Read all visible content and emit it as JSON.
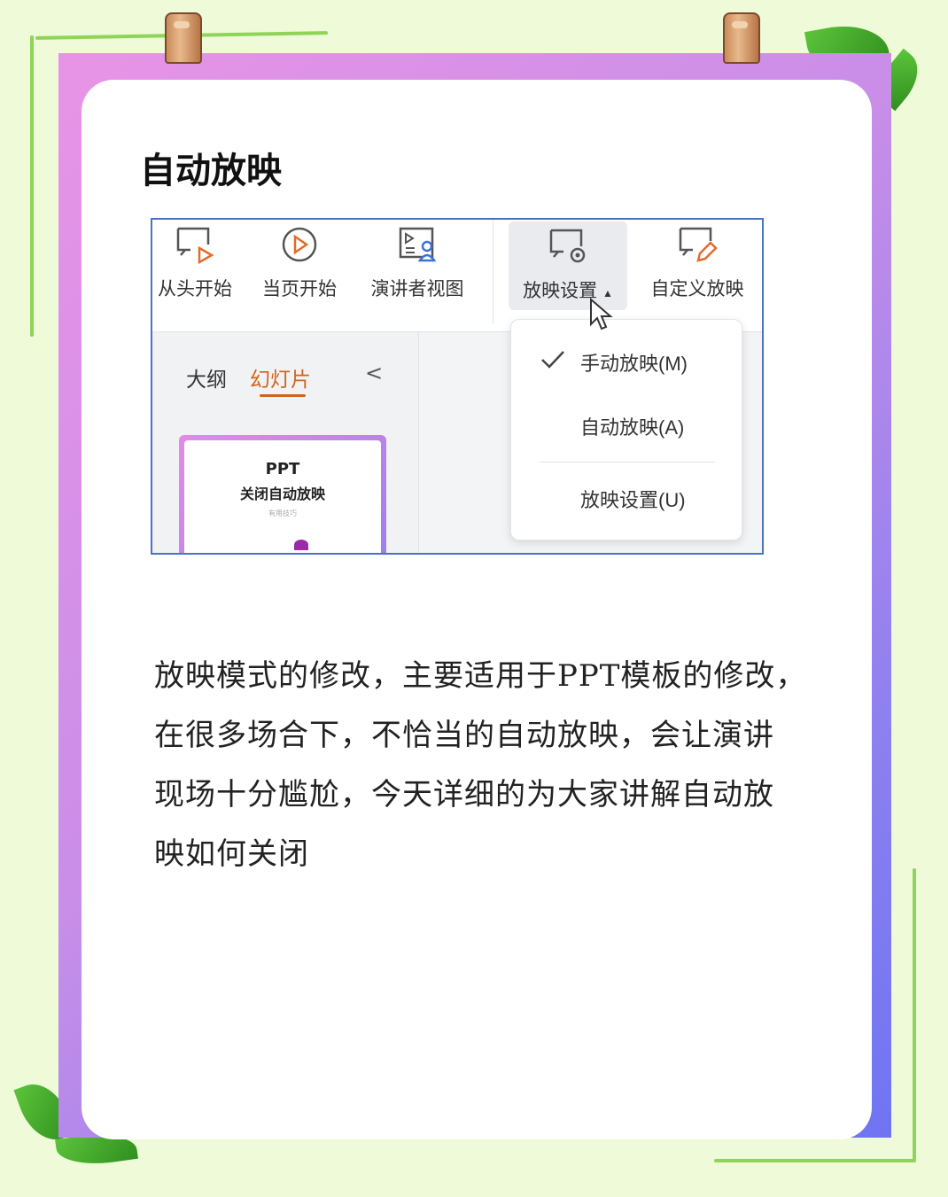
{
  "post": {
    "title": "自动放映",
    "body_lines": [
      "放映模式的修改，主要适用于PPT模板的修改，",
      "在很多场合下，不恰当的自动放映，会让演讲",
      "现场十分尴尬，今天详细的为大家讲解自动放",
      "映如何关闭"
    ]
  },
  "screenshot": {
    "toolbar": {
      "from_start": "从头开始",
      "from_current": "当页开始",
      "presenter_view": "演讲者视图",
      "slideshow_settings": "放映设置",
      "custom_show": "自定义放映"
    },
    "panel": {
      "tab_outline": "大纲",
      "tab_slides": "幻灯片",
      "collapse_glyph": "<",
      "thumb_line1": "PPT",
      "thumb_line2": "关闭自动放映",
      "thumb_line3": "有用技巧"
    },
    "dropdown": {
      "check_glyph": "✓",
      "manual": "手动放映(M)",
      "auto": "自动放映(A)",
      "settings": "放映设置(U)"
    }
  },
  "colors": {
    "frame_gradient_start": "#e894e6",
    "frame_gradient_end": "#6f74f2",
    "active_tab": "#d0641e",
    "screenshot_border": "#4a73c8",
    "background": "#eefad8"
  },
  "icons": [
    "play-from-start-icon",
    "play-current-icon",
    "presenter-view-icon",
    "slideshow-settings-icon",
    "custom-show-icon",
    "check-icon",
    "mouse-cursor-icon",
    "clip-icon",
    "leaf-icon"
  ]
}
